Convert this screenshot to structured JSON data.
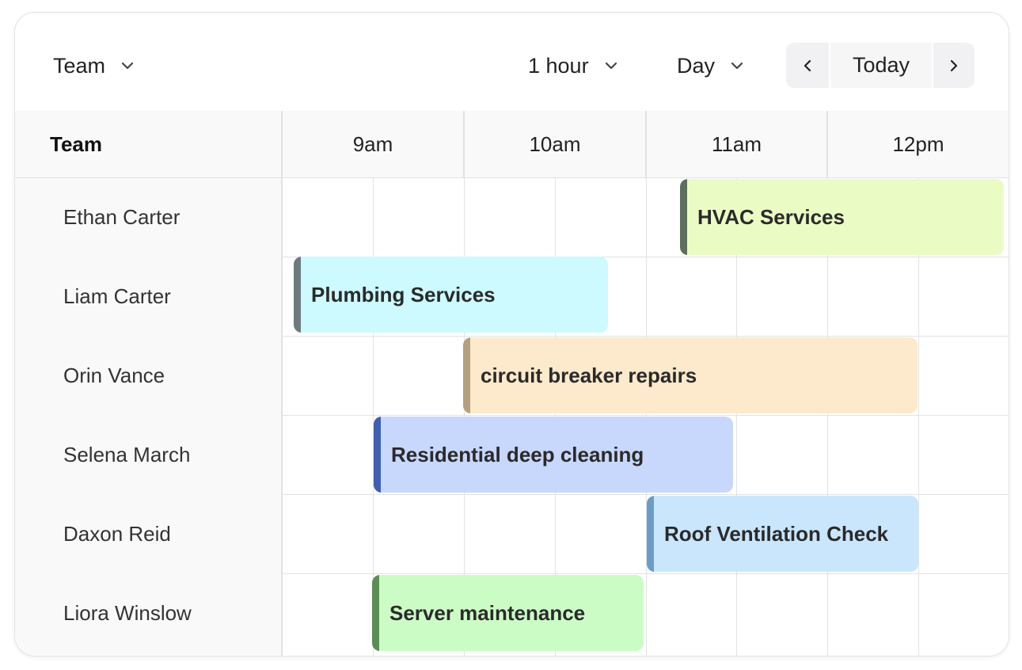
{
  "toolbar": {
    "group_select": "Team",
    "interval_select": "1 hour",
    "view_select": "Day",
    "today_label": "Today"
  },
  "sidebar": {
    "header": "Team",
    "people": [
      "Ethan Carter",
      "Liam Carter",
      "Orin Vance",
      "Selena March",
      "Daxon Reid",
      "Liora Winslow"
    ]
  },
  "timeline": {
    "hours": [
      "9am",
      "10am",
      "11am",
      "12pm"
    ]
  },
  "events": [
    {
      "title": "HVAC Services",
      "person": "Ethan Carter",
      "start": "11:10",
      "end": "12:45",
      "fill": "#eafcc4",
      "accent": "#5d6f5d"
    },
    {
      "title": "Plumbing Services",
      "person": "Liam Carter",
      "start": "9:00",
      "end": "10:45",
      "fill": "#ccfafe",
      "accent": "#6e7b7c"
    },
    {
      "title": "circuit breaker repairs",
      "person": "Orin Vance",
      "start": "10:00",
      "end": "12:25",
      "fill": "#fde9cb",
      "accent": "#b5a07e"
    },
    {
      "title": "Residential deep cleaning",
      "person": "Selena March",
      "start": "9:30",
      "end": "11:30",
      "fill": "#c8d7fc",
      "accent": "#3f5fb1"
    },
    {
      "title": "Roof Ventilation Check",
      "person": "Daxon Reid",
      "start": "11:00",
      "end": "12:30",
      "fill": "#c9e6fd",
      "accent": "#6b9cc7"
    },
    {
      "title": "Server maintenance",
      "person": "Liora Winslow",
      "start": "9:30",
      "end": "11:00",
      "fill": "#ccfcc6",
      "accent": "#5b8e55"
    }
  ],
  "icons": {
    "dropdown": "chevron-down-icon",
    "prev": "chevron-left-icon",
    "next": "chevron-right-icon"
  }
}
